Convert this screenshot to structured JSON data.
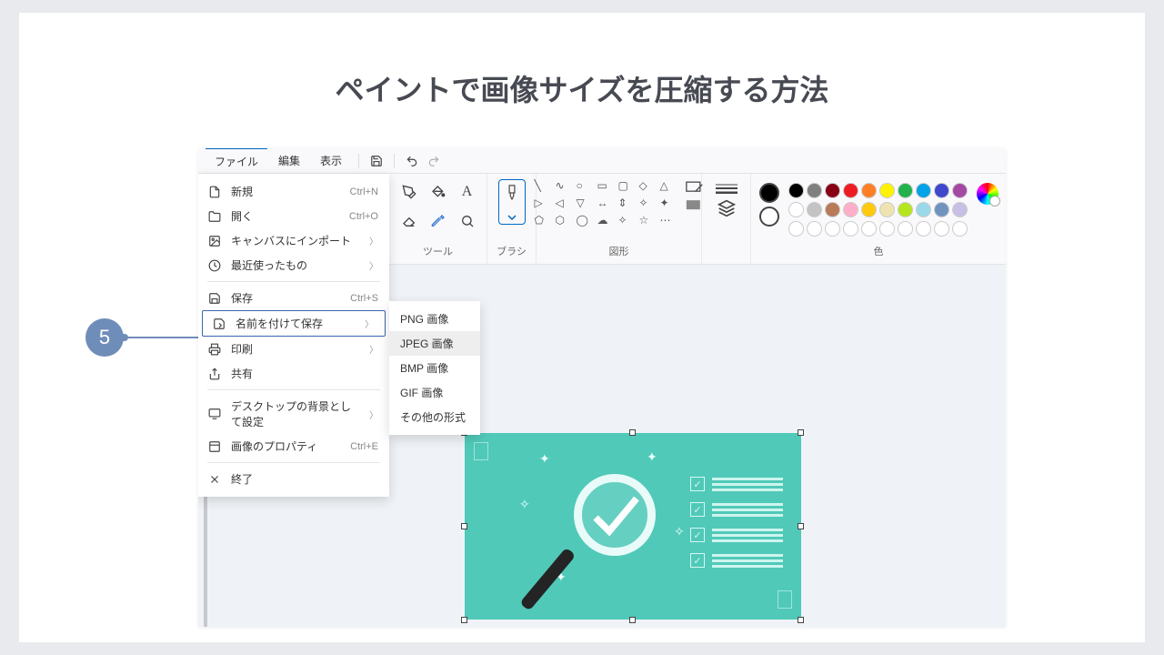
{
  "page": {
    "title": "ペイントで画像サイズを圧縮する方法",
    "step_badge": "5"
  },
  "menubar": {
    "file": "ファイル",
    "edit": "編集",
    "view": "表示"
  },
  "ribbon": {
    "tools_label": "ツール",
    "brushes_label": "ブラシ",
    "shapes_label": "図形",
    "colors_label": "色"
  },
  "file_menu": {
    "new": {
      "label": "新規",
      "shortcut": "Ctrl+N"
    },
    "open": {
      "label": "開く",
      "shortcut": "Ctrl+O"
    },
    "import": {
      "label": "キャンバスにインポート"
    },
    "recent": {
      "label": "最近使ったもの"
    },
    "save": {
      "label": "保存",
      "shortcut": "Ctrl+S"
    },
    "saveas": {
      "label": "名前を付けて保存"
    },
    "print": {
      "label": "印刷"
    },
    "share": {
      "label": "共有"
    },
    "wallpaper": {
      "label": "デスクトップの背景として設定"
    },
    "properties": {
      "label": "画像のプロパティ",
      "shortcut": "Ctrl+E"
    },
    "exit": {
      "label": "終了"
    }
  },
  "saveas_submenu": {
    "png": "PNG 画像",
    "jpeg": "JPEG 画像",
    "bmp": "BMP 画像",
    "gif": "GIF 画像",
    "other": "その他の形式"
  },
  "palette": {
    "row1": [
      "#000000",
      "#7f7f7f",
      "#880015",
      "#ed1c24",
      "#ff7f27",
      "#fff200",
      "#22b14c",
      "#00a2e8",
      "#3f48cc",
      "#a349a4"
    ],
    "row2": [
      "#ffffff",
      "#c3c3c3",
      "#b97a57",
      "#ffaec9",
      "#ffc90e",
      "#efe4b0",
      "#b5e61d",
      "#99d9ea",
      "#7092be",
      "#c8bfe7"
    ]
  }
}
